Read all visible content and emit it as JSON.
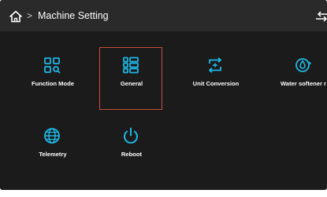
{
  "header": {
    "breadcrumb_separator": ">",
    "title": "Machine Setting",
    "home_icon": "home-icon",
    "back_icon": "back-icon"
  },
  "colors": {
    "background": "#1b1b1b",
    "header_background": "#2a2a2a",
    "accent": "#1fb7e6",
    "selection_border": "#c74f3b",
    "text": "#ffffff"
  },
  "menu": {
    "items": [
      {
        "label": "Function Mode",
        "icon": "function-mode-icon",
        "selected": false
      },
      {
        "label": "General",
        "icon": "general-list-icon",
        "selected": true
      },
      {
        "label": "Unit Conversion",
        "icon": "unit-conversion-icon",
        "selected": false
      },
      {
        "label": "Water softener r",
        "icon": "water-softener-icon",
        "selected": false
      },
      {
        "label": "Telemetry",
        "icon": "globe-icon",
        "selected": false
      },
      {
        "label": "Reboot",
        "icon": "power-icon",
        "selected": false
      }
    ]
  }
}
